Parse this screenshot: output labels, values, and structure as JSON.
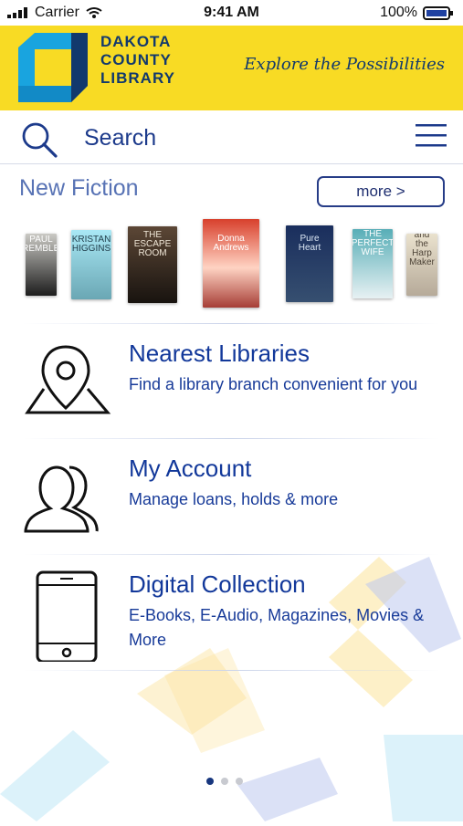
{
  "status_bar": {
    "carrier": "Carrier",
    "time": "9:41 AM",
    "battery": "100%"
  },
  "header": {
    "logo_text": [
      "DAKOTA",
      "COUNTY",
      "LIBRARY"
    ],
    "tagline": "Explore the Possibilities",
    "brand_color": "#f8db24",
    "logo_color": "#12396d",
    "logo_accent": "#19a4df"
  },
  "search": {
    "label": "Search"
  },
  "new_fiction": {
    "title": "New Fiction",
    "more_label": "more >",
    "books": [
      {
        "top": "PAUL TREMBLEY",
        "bottom": ""
      },
      {
        "top": "KRISTAN HIGGINS",
        "bottom": ""
      },
      {
        "top": "THE ESCAPE ROOM",
        "bottom": "MEGAN GOLDIN"
      },
      {
        "top": "Donna Andrews",
        "bottom": "Terns of Endearment"
      },
      {
        "top": "Pure Heart",
        "bottom": ""
      },
      {
        "top": "THE PERFECT WIFE",
        "bottom": "JP DELANEY"
      },
      {
        "top": "Ellie and the Harp Maker",
        "bottom": ""
      }
    ]
  },
  "menu_items": [
    {
      "title": "Nearest Libraries",
      "subtitle": "Find a library branch convenient for you"
    },
    {
      "title": "My Account",
      "subtitle": "Manage loans, holds & more"
    },
    {
      "title": "Digital Collection",
      "subtitle": "E-Books, E-Audio, Magazines, Movies & More"
    }
  ],
  "pagination": {
    "current_page": 1,
    "page_count": 3
  },
  "icons": [
    "signal-icon",
    "wifi-icon",
    "battery-icon",
    "search-icon",
    "menu-icon",
    "map-pin-icon",
    "people-icon",
    "tablet-icon"
  ]
}
